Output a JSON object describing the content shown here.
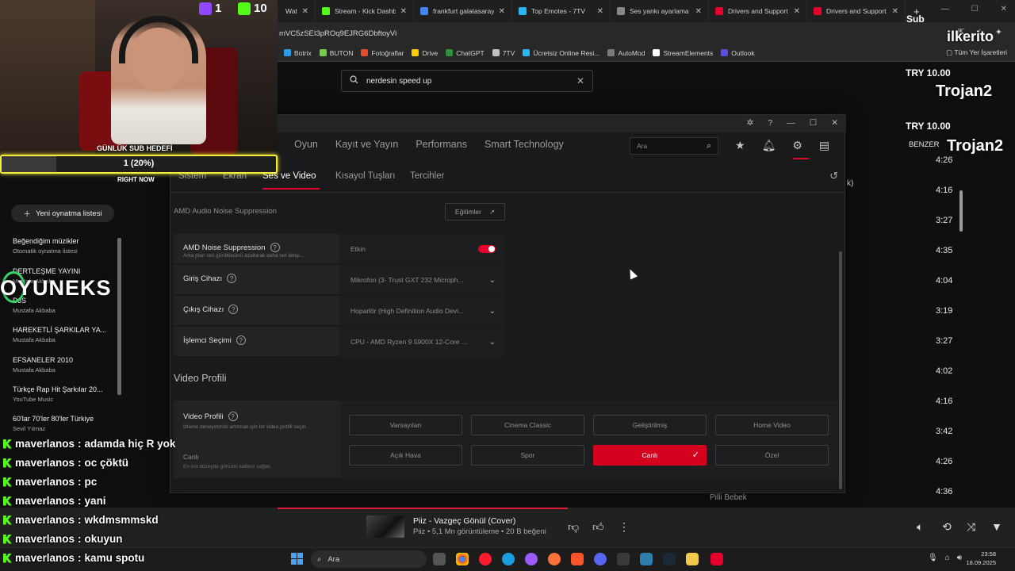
{
  "browser": {
    "tabs": [
      {
        "label": "Wat",
        "color": "#9146ff"
      },
      {
        "label": "Stream - Kick Dashbo",
        "color": "#53fc18"
      },
      {
        "label": "frankfurt galatasaray",
        "color": "#4285f4"
      },
      {
        "label": "Top Emotes - 7TV",
        "color": "#29b6f6"
      },
      {
        "label": "Ses yankı ayarlama u",
        "color": "#888888"
      },
      {
        "label": "Drivers and Support",
        "color": "#e4002b"
      },
      {
        "label": "Drivers and Support",
        "color": "#e4002b"
      }
    ],
    "new_tab": "+",
    "url": "mVC5zSEI3pROq9EJRG6DbftoyVi",
    "bookmarks": [
      "Botrix",
      "BUTON",
      "Fotoğraflar",
      "Drive",
      "ChatGPT",
      "7TV",
      "Ücretsiz Online Resi...",
      "AutoMod",
      "StreamElements",
      "Outlook"
    ],
    "bookmarks_all": "Tüm Yer İşaretleri"
  },
  "youtube": {
    "search_value": "nerdesin speed up",
    "new_playlist": "Yeni oynatma listesi",
    "playlists": [
      {
        "title": "Beğendiğim müzikler",
        "sub": "Otomatik oynatma listesi"
      },
      {
        "title": "DERTLEŞME YAYINI",
        "sub": "Mustafa Akbaba"
      },
      {
        "title": "DJS",
        "sub": "Mustafa Akbaba"
      },
      {
        "title": "HAREKETLİ ŞARKILAR YA...",
        "sub": "Mustafa Akbaba"
      },
      {
        "title": "EFSANELER 2010",
        "sub": "Mustafa Akbaba"
      },
      {
        "title": "Türkçe Rap Hit Şarkılar 20...",
        "sub": "YouTube Music"
      },
      {
        "title": "60'lar 70'ler 80'ler Türkiye",
        "sub": "Sevil Yılmaz"
      }
    ],
    "queue_label": "BENZER",
    "durations": [
      "4:26",
      "4:16",
      "3:27",
      "4:35",
      "4:04",
      "3:19",
      "3:27",
      "4:02",
      "4:16",
      "3:42",
      "4:26",
      "4:36"
    ],
    "partial_text": "k)",
    "queue_last": "Pilli Bebek",
    "now_playing": {
      "title": "Piiz - Vazgeç Gönül (Cover)",
      "meta": "Piiz • 5,1 Mn görüntüleme • 20 B beğeni"
    }
  },
  "amd": {
    "nav": [
      "Oyun",
      "Kayıt ve Yayın",
      "Performans",
      "Smart Technology"
    ],
    "search_placeholder": "Ara",
    "subtabs": [
      "Sistem",
      "Ekran",
      "Ses ve Video",
      "Kısayol Tuşları",
      "Tercihler"
    ],
    "active_subtab": "Ses ve Video",
    "section_title": "AMD Audio Noise Suppression",
    "tutorials": "Eğitimler",
    "rows": [
      {
        "label": "AMD Noise Suppression",
        "desc": "Arka plan ses gürültüsünü azaltarak daha net iletişi...",
        "value": "Etkin",
        "type": "toggle",
        "on": true
      },
      {
        "label": "Giriş Cihazı",
        "desc": "",
        "value": "Mikrofon (3- Trust GXT 232 Microph...",
        "type": "dropdown"
      },
      {
        "label": "Çıkış Cihazı",
        "desc": "",
        "value": "Hoparlör (High Definition Audio Devi...",
        "type": "dropdown"
      },
      {
        "label": "İşlemci Seçimi",
        "desc": "",
        "value": "CPU - AMD Ryzen 9 5900X 12-Core ...",
        "type": "dropdown"
      }
    ],
    "video_title": "Video Profili",
    "video_label": "Video Profili",
    "video_desc": "İzleme deneyiminizi artırmak için bir video profili seçin.",
    "video_current": "Canlı",
    "video_current_desc": "En üst düzeyde görüntü kalitesi sağlar.",
    "profiles": [
      "Varsayılan",
      "Cinema Classic",
      "Geliştirilmiş",
      "Home Video",
      "Açık Hava",
      "Spor",
      "Canlı",
      "Özel"
    ],
    "selected_profile": "Canlı",
    "accent": "#e4002b"
  },
  "stream": {
    "twitch_count": "1",
    "kick_count": "10",
    "goal_label": "GÜNLÜK SUB HEDEFİ",
    "goal_value": "1 (20%)",
    "goal_fraction": 0.2,
    "right_now": "RIGHT NOW",
    "sponsor": "OYUNEKS",
    "sub_label": "Sub",
    "sub_name": "ilkerito",
    "donation1_amount": "TRY 10.00",
    "donation1_name": "Trojan2",
    "donation2_amount": "TRY 10.00",
    "donation2_name": "Trojan2",
    "chat": [
      {
        "user": "maverlanos",
        "msg": "adamda hiç R yok"
      },
      {
        "user": "maverlanos",
        "msg": "oc çöktü"
      },
      {
        "user": "maverlanos",
        "msg": "pc"
      },
      {
        "user": "maverlanos",
        "msg": "yani"
      },
      {
        "user": "maverlanos",
        "msg": "wkdmsmmskd"
      },
      {
        "user": "maverlanos",
        "msg": "okuyun"
      },
      {
        "user": "maverlanos",
        "msg": "kamu spotu"
      }
    ]
  },
  "taskbar": {
    "search": "Ara",
    "time": "23:58",
    "date": "18.09.2025"
  }
}
